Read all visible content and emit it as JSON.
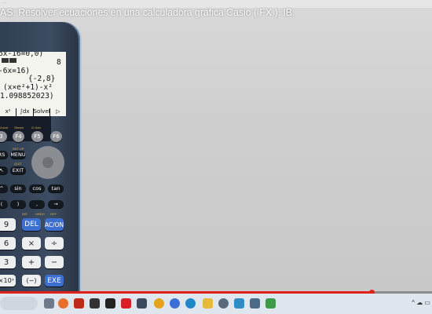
{
  "video": {
    "title": "AS: Resolver ecuaciones en una calculadora gráfica Casio ( FX ). IB.",
    "top_strip_text": "...",
    "progress": 0.86
  },
  "calculator": {
    "screen_lines": [
      "6x-16=0,0)",
      "8",
      "-6x=16)",
      "{-2,8}",
      "(x×e²+1)-x²",
      "1.098852023)"
    ],
    "fkeys": [
      "x²",
      "∫dx",
      "SolveN",
      "▷"
    ],
    "f_labels": [
      "3",
      "F4",
      "F5",
      "F6"
    ],
    "keys": {
      "row1": [
        "RS",
        "MENU"
      ],
      "row2": [
        "EXIT"
      ],
      "row3": [
        "^",
        "sin",
        "cos",
        "tan"
      ],
      "row4": [
        "(",
        ")",
        ",",
        "→"
      ],
      "row5": [
        "9",
        "DEL",
        "AC/ON"
      ],
      "row6": [
        "6",
        "×",
        "÷"
      ],
      "row7": [
        "3",
        "+",
        "−"
      ],
      "row8": [
        "×10ˣ",
        "(−)",
        "EXE"
      ]
    },
    "small_labels": [
      "Sketch",
      "G-Solv",
      "SET UP",
      "QUIT",
      "INS",
      "UNDO",
      "OFF"
    ]
  },
  "taskbar": {
    "icons": [
      "search-box",
      "file-explorer-icon",
      "firefox-icon",
      "filezilla-icon",
      "chat-icon",
      "netflix-icon",
      "app-icon",
      "chrome-icon",
      "browser-icon",
      "edge-icon",
      "folder-icon",
      "app-icon-2",
      "app-icon-3",
      "app-icon-4"
    ],
    "tray_text": "^ ☁ ▭"
  },
  "colors": {
    "progress": "#e0201b",
    "title": "#ffffff",
    "calc_body": "#2c3a4c",
    "ac_key": "#3c6fd0"
  }
}
